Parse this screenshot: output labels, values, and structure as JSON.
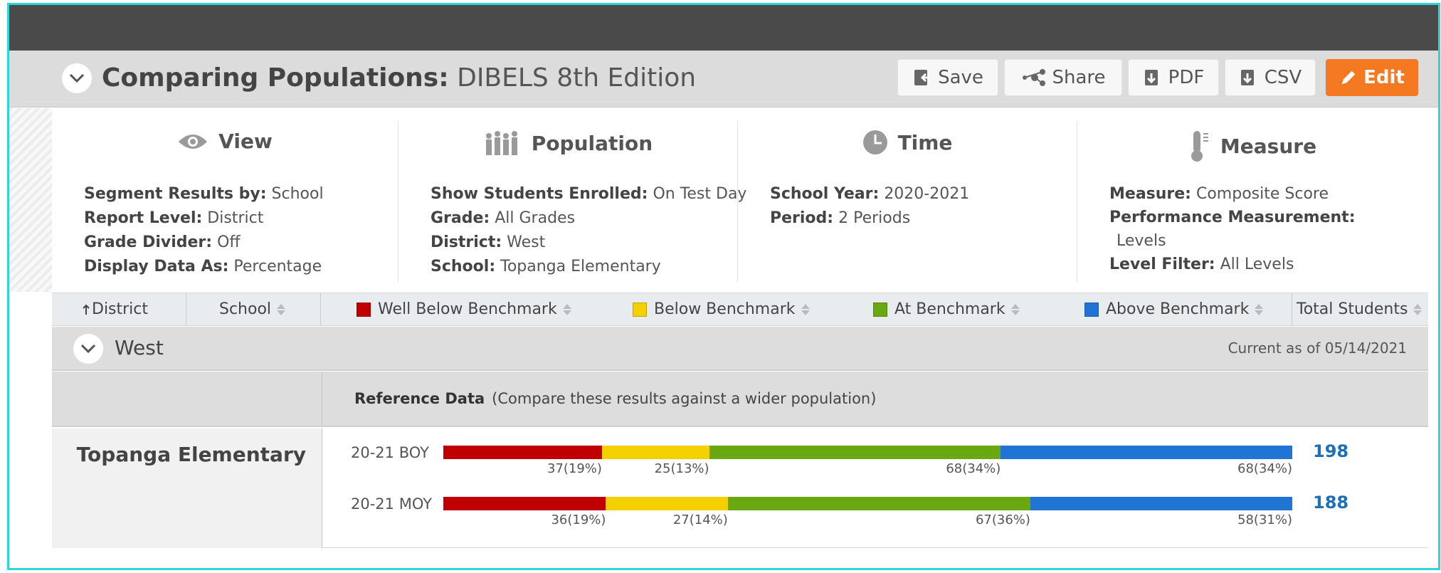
{
  "report": {
    "title_main": "Comparing Populations:",
    "title_sub": "DIBELS 8th Edition"
  },
  "toolbar": {
    "save": "Save",
    "share": "Share",
    "pdf": "PDF",
    "csv": "CSV",
    "edit": "Edit"
  },
  "params": {
    "view": {
      "heading": "View",
      "icon": "eye-icon",
      "lines": [
        {
          "label": "Segment Results by:",
          "value": "School"
        },
        {
          "label": "Report Level:",
          "value": "District"
        },
        {
          "label": "Grade Divider:",
          "value": "Off"
        },
        {
          "label": "Display Data As:",
          "value": "Percentage"
        }
      ]
    },
    "population": {
      "heading": "Population",
      "icon": "people-icon",
      "lines": [
        {
          "label": "Show Students Enrolled:",
          "value": "On Test Day"
        },
        {
          "label": "Grade:",
          "value": "All Grades"
        },
        {
          "label": "District:",
          "value": "West"
        },
        {
          "label": "School:",
          "value": "Topanga Elementary"
        }
      ]
    },
    "time": {
      "heading": "Time",
      "icon": "clock-icon",
      "lines": [
        {
          "label": "School Year:",
          "value": "2020-2021"
        },
        {
          "label": "Period:",
          "value": "2 Periods"
        }
      ]
    },
    "measure": {
      "heading": "Measure",
      "icon": "thermometer-icon",
      "lines": [
        {
          "label": "Measure:",
          "value": "Composite Score"
        },
        {
          "label": "Performance Measurement:",
          "value": ""
        },
        {
          "label": "",
          "value": "Levels"
        },
        {
          "label": "Level Filter:",
          "value": "All Levels"
        }
      ]
    }
  },
  "columns": {
    "district": "District",
    "school": "School",
    "well_below": "Well Below Benchmark",
    "below": "Below Benchmark",
    "at": "At Benchmark",
    "above": "Above Benchmark",
    "total": "Total Students"
  },
  "colors": {
    "well_below": "#c00000",
    "below": "#f5d000",
    "at": "#6aa812",
    "above": "#1f74d4"
  },
  "group": {
    "name": "West",
    "current_as_of": "Current as of 05/14/2021"
  },
  "reference": {
    "label": "Reference Data",
    "note": "(Compare these results against a wider population)"
  },
  "school_row": {
    "name": "Topanga Elementary",
    "periods": [
      {
        "label": "20-21 BOY",
        "total": "198",
        "segments": [
          {
            "key": "well_below",
            "count": 37,
            "text": "37(19%)"
          },
          {
            "key": "below",
            "count": 25,
            "text": "25(13%)"
          },
          {
            "key": "at",
            "count": 68,
            "text": "68(34%)"
          },
          {
            "key": "above",
            "count": 68,
            "text": "68(34%)"
          }
        ]
      },
      {
        "label": "20-21 MOY",
        "total": "188",
        "segments": [
          {
            "key": "well_below",
            "count": 36,
            "text": "36(19%)"
          },
          {
            "key": "below",
            "count": 27,
            "text": "27(14%)"
          },
          {
            "key": "at",
            "count": 67,
            "text": "67(36%)"
          },
          {
            "key": "above",
            "count": 58,
            "text": "58(31%)"
          }
        ]
      }
    ]
  }
}
